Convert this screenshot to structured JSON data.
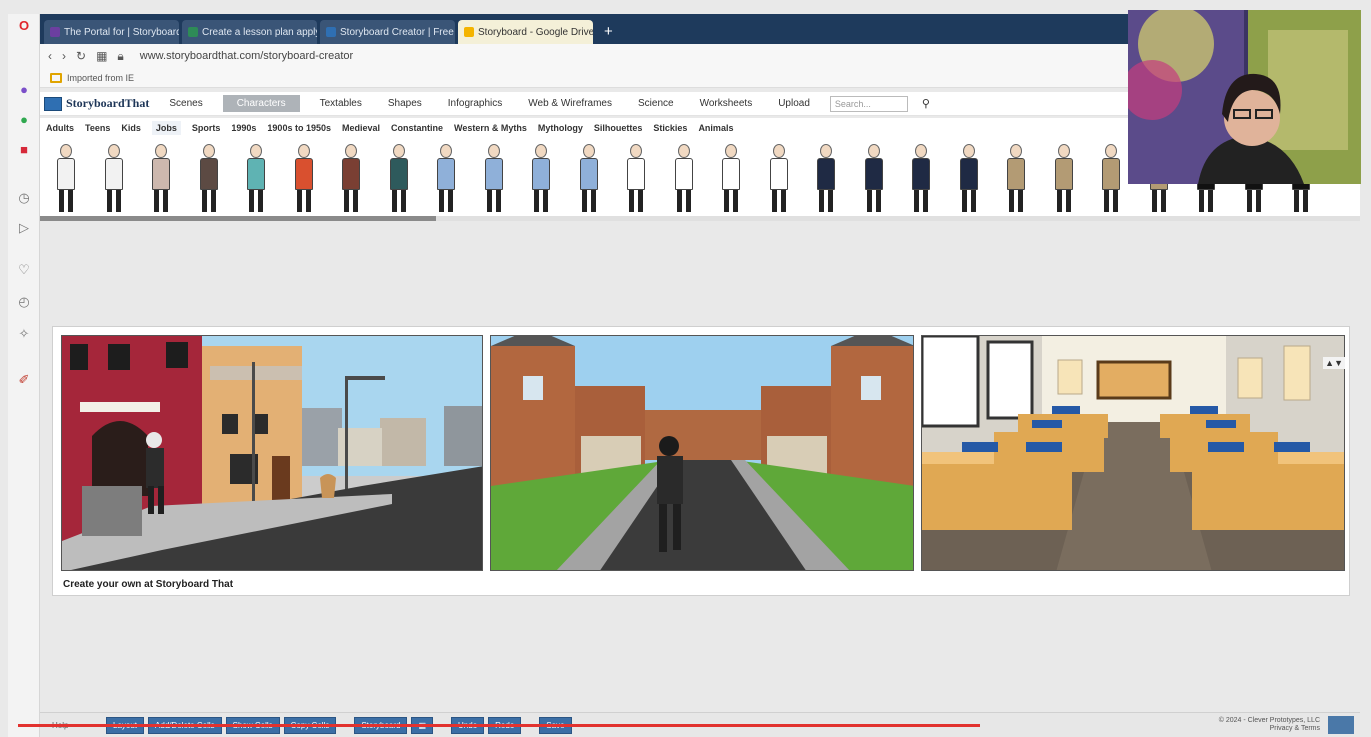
{
  "browser": {
    "tabs": [
      {
        "label": "The Portal for | Storyboarder...",
        "active": false,
        "favicon_color": "#6c3fa0"
      },
      {
        "label": "Create a lesson plan apply l...",
        "active": false,
        "favicon_color": "#2e8b57"
      },
      {
        "label": "Storyboard Creator | Free",
        "active": false,
        "favicon_color": "#2f6fb2"
      },
      {
        "label": "Storyboard - Google Drive",
        "active": true,
        "favicon_color": "#f4b400"
      }
    ],
    "url": "www.storyboardthat.com/storyboard-creator",
    "bookmark_label": "Imported from IE"
  },
  "app": {
    "logo": "StoryboardThat",
    "nav_tabs": [
      "Scenes",
      "Characters",
      "Textables",
      "Shapes",
      "Infographics",
      "Web & Wireframes",
      "Science",
      "Worksheets",
      "Upload"
    ],
    "active_nav_tab": "Characters",
    "search_placeholder": "Search...",
    "categories": [
      "Adults",
      "Teens",
      "Kids",
      "Jobs",
      "Sports",
      "1990s",
      "1900s to 1950s",
      "Medieval",
      "Constantine",
      "Western & Myths",
      "Mythology",
      "Silhouettes",
      "Stickies",
      "Animals"
    ],
    "active_category": "Jobs",
    "characters": [
      {
        "outfit": "#f2f2f2"
      },
      {
        "outfit": "#f2f2f2"
      },
      {
        "outfit": "#cdb8ae"
      },
      {
        "outfit": "#5c4a43"
      },
      {
        "outfit": "#5fb3b3"
      },
      {
        "outfit": "#d9502f"
      },
      {
        "outfit": "#7a3f33"
      },
      {
        "outfit": "#2e5a5c"
      },
      {
        "outfit": "#8fb0d9"
      },
      {
        "outfit": "#8fb0d9"
      },
      {
        "outfit": "#8fb0d9"
      },
      {
        "outfit": "#8fb0d9"
      },
      {
        "outfit": "#ffffff"
      },
      {
        "outfit": "#ffffff"
      },
      {
        "outfit": "#ffffff"
      },
      {
        "outfit": "#ffffff"
      },
      {
        "outfit": "#1f2a44"
      },
      {
        "outfit": "#1f2a44"
      },
      {
        "outfit": "#1f2a44"
      },
      {
        "outfit": "#1f2a44"
      },
      {
        "outfit": "#b39b74"
      },
      {
        "outfit": "#b39b74"
      },
      {
        "outfit": "#b39b74"
      },
      {
        "outfit": "#b39b74"
      },
      {
        "outfit": "#111111"
      },
      {
        "outfit": "#111111"
      },
      {
        "outfit": "#111111"
      }
    ],
    "board_footer": "Create your own at Storyboard That",
    "cell_arrows": "▲▼"
  },
  "toolbar": {
    "help": "Help",
    "buttons": [
      "Layout",
      "Add/Delete Cells",
      "Show Cells",
      "Copy Cells",
      "Storyboard",
      "Undo",
      "Redo",
      "Save"
    ],
    "copyright": "© 2024 - Clever Prototypes, LLC",
    "copyright_sub": "Privacy & Terms"
  },
  "video": {
    "progress_fraction": 0.715
  },
  "colors": {
    "tabstrip": "#1e3a5c",
    "toolbar_button": "#3b6ea5",
    "progress": "#e2322f"
  }
}
